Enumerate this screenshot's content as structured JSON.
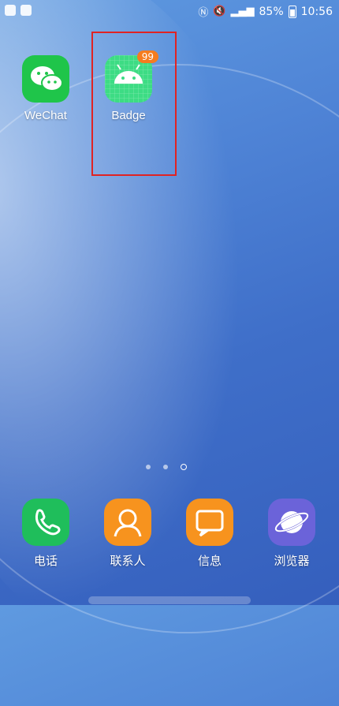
{
  "status_bar": {
    "battery_percent": "85%",
    "time": "10:56"
  },
  "apps": [
    {
      "label": "WeChat",
      "icon": "wechat-icon"
    },
    {
      "label": "Badge",
      "icon": "android-icon",
      "badge": "99"
    }
  ],
  "page_indicator": {
    "count": 3,
    "active": 3
  },
  "dock": [
    {
      "label": "电话",
      "icon": "phone-icon"
    },
    {
      "label": "联系人",
      "icon": "contacts-icon"
    },
    {
      "label": "信息",
      "icon": "message-icon"
    },
    {
      "label": "浏览器",
      "icon": "browser-icon"
    }
  ],
  "colors": {
    "highlight": "#e02323",
    "badge": "#f57c1f"
  }
}
